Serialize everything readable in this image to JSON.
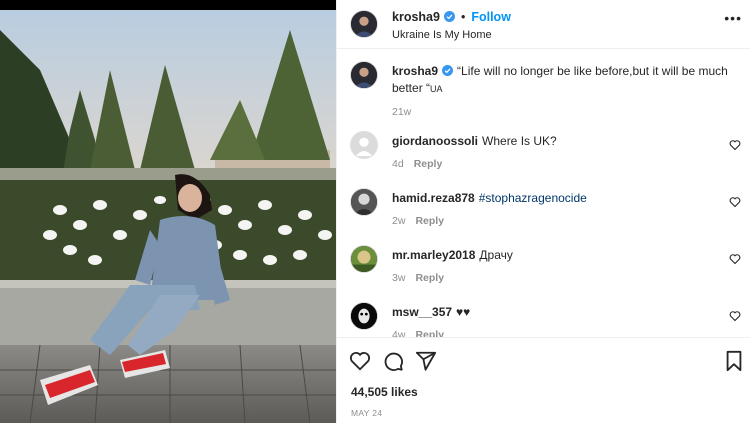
{
  "post": {
    "author": "krosha9",
    "follow_label": "Follow",
    "dot": "•",
    "location": "Ukraine Is My Home",
    "more_icon": "more-horizontal-icon"
  },
  "caption": {
    "username": "krosha9",
    "text": "“Life will no longer be like before,but it will be much better “",
    "flag": "UA",
    "time": "21w"
  },
  "comments": [
    {
      "username": "giordanoossoli",
      "text": "Where Is UK?",
      "time": "4d",
      "reply_label": "Reply"
    },
    {
      "username": "hamid.reza878",
      "text": "#stophazragenocide",
      "time": "2w",
      "reply_label": "Reply"
    },
    {
      "username": "mr.marley2018",
      "text": "Драчу",
      "time": "3w",
      "reply_label": "Reply"
    },
    {
      "username": "msw__357",
      "text": "♥♥",
      "time": "4w",
      "reply_label": "Reply"
    }
  ],
  "actions": {
    "icons": [
      "heart-icon",
      "comment-icon",
      "share-icon",
      "bookmark-icon"
    ],
    "likes": "44,505 likes",
    "date": "MAY 24"
  },
  "colors": {
    "accent": "#0095f6",
    "hashtag": "#00376b",
    "muted": "#8e8e8e"
  }
}
